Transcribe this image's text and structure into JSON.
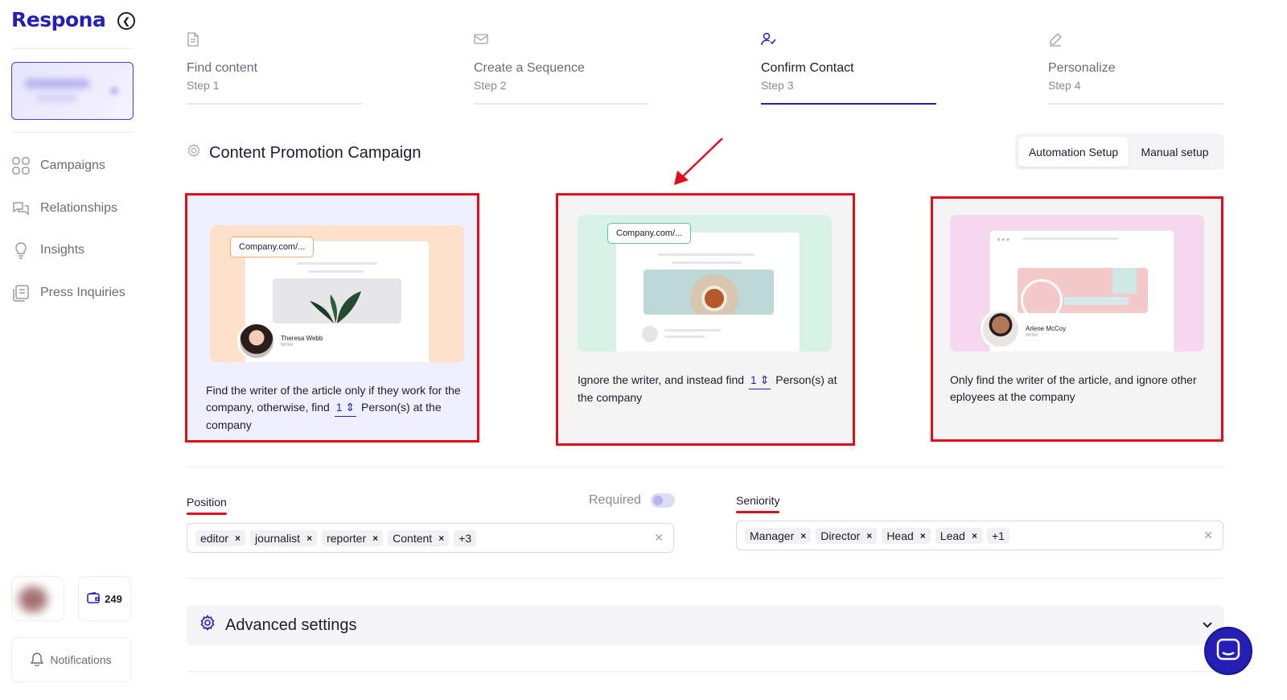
{
  "app": {
    "logo": "Respona"
  },
  "sidebar": {
    "nav": [
      {
        "label": "Campaigns",
        "icon": "grid-icon"
      },
      {
        "label": "Relationships",
        "icon": "chat-bubbles-icon"
      },
      {
        "label": "Insights",
        "icon": "lightbulb-icon"
      },
      {
        "label": "Press Inquiries",
        "icon": "newspaper-icon"
      }
    ],
    "credits": "249",
    "notifications_label": "Notifications"
  },
  "steps": [
    {
      "title": "Find content",
      "sub": "Step 1",
      "icon": "document-icon"
    },
    {
      "title": "Create a Sequence",
      "sub": "Step 2",
      "icon": "envelope-icon"
    },
    {
      "title": "Confirm Contact",
      "sub": "Step 3",
      "icon": "user-check-icon",
      "active": true
    },
    {
      "title": "Personalize",
      "sub": "Step 4",
      "icon": "pencil-icon"
    }
  ],
  "campaign": {
    "title": "Content Promotion Campaign"
  },
  "setup": {
    "automation": "Automation Setup",
    "manual": "Manual setup",
    "selected": "Automation Setup"
  },
  "options": [
    {
      "url": "Company.com/...",
      "person_name": "Theresa Webb",
      "person_role": "Writer",
      "text_a": "Find the writer of the article only if they work for the company, otherwise, find",
      "count": "1",
      "text_b": "Person(s) at the company",
      "accent": "#fde2c9",
      "selected": true
    },
    {
      "url": "Company.com/...",
      "text_a": "Ignore the writer, and instead find",
      "count": "1",
      "text_b": "Person(s) at the company",
      "accent": "#d8f3e6"
    },
    {
      "person_name": "Arlene McCoy",
      "person_role": "Writer",
      "text": "Only find the writer of the article, and ignore other eployees at the company",
      "accent": "#f5d8f0"
    }
  ],
  "position": {
    "label": "Position",
    "required_label": "Required",
    "required": false,
    "tags": [
      "editor",
      "journalist",
      "reporter",
      "Content"
    ],
    "more": "+3"
  },
  "seniority": {
    "label": "Seniority",
    "tags": [
      "Manager",
      "Director",
      "Head",
      "Lead"
    ],
    "more": "+1"
  },
  "advanced": {
    "label": "Advanced settings"
  },
  "colors": {
    "brand": "#251fb5",
    "highlight": "#e10d1a"
  }
}
